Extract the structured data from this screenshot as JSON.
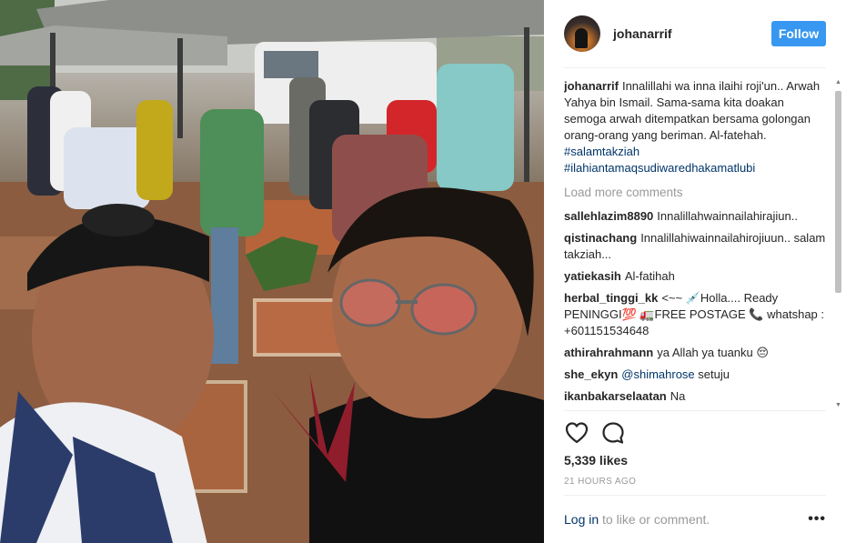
{
  "post": {
    "username": "johanarrif",
    "follow_label": "Follow",
    "photo_alt": "Selfie of two men at a cemetery"
  },
  "caption": {
    "username": "johanarrif",
    "text": "Innalillahi wa inna ilaihi roji'un.. Arwah Yahya bin Ismail. Sama-sama kita doakan semoga arwah ditempatkan bersama golongan orang-orang yang beriman. Al-fatehah.",
    "hashtags": [
      "#salamtakziah",
      "#ilahiantamaqsudiwaredhakamatlubi"
    ]
  },
  "load_more_label": "Load more comments",
  "comments": [
    {
      "username": "sallehlazim8890",
      "text": "Innalillahwainnailahirajiun.."
    },
    {
      "username": "qistinachang",
      "text": "Innalillahiwainnailahirojiuun.. salam takziah..."
    },
    {
      "username": "yatiekasih",
      "text": "Al-fatihah"
    },
    {
      "username": "herbal_tinggi_kk",
      "text": "<~~ 💉Holla.... Ready PENINGGI💯 🚛FREE POSTAGE 📞 whatshap : +601151534648"
    },
    {
      "username": "athirahrahmann",
      "text": "ya Allah ya tuanku 😔"
    },
    {
      "username": "she_ekyn",
      "mention": "@shimahrose",
      "text": "setuju"
    },
    {
      "username": "ikanbakarselaatan",
      "text": "Na"
    }
  ],
  "likes": "5,339 likes",
  "timestamp": "21 HOURS AGO",
  "login": {
    "link_label": "Log in",
    "rest_text": "to like or comment."
  },
  "more_options_label": "•••",
  "icons": {
    "heart": "heart-icon",
    "comment": "comment-icon",
    "scroll_up": "scroll-up-arrow-icon",
    "scroll_down": "scroll-down-arrow-icon"
  },
  "colors": {
    "follow_button": "#3897f0",
    "link": "#003569",
    "muted": "#999999",
    "text": "#262626"
  }
}
